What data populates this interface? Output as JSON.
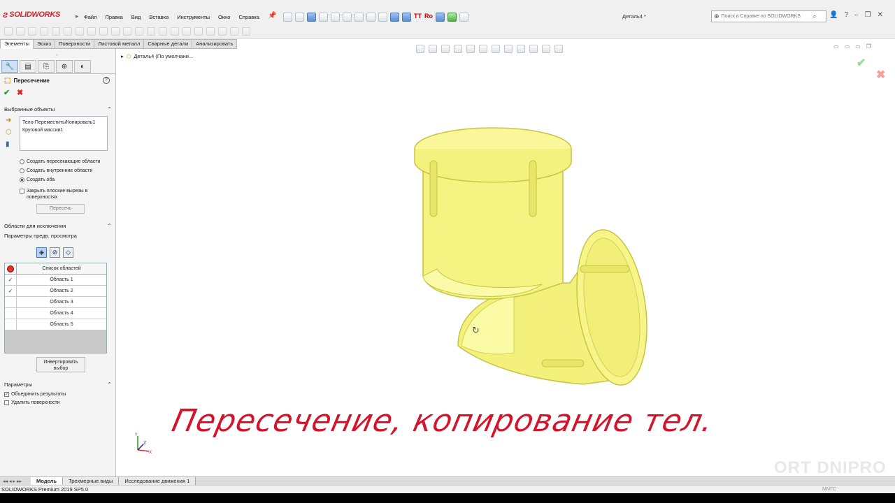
{
  "app": {
    "brand": "SOLIDWORKS",
    "document_title": "Деталь4 *",
    "status": "SOLIDWORKS Premium 2019 SP5.0",
    "units": "ММГС"
  },
  "menu": [
    "Файл",
    "Правка",
    "Вид",
    "Вставка",
    "Инструменты",
    "Окно",
    "Справка"
  ],
  "search": {
    "placeholder": "Поиск в Справке по SOLIDWORKS"
  },
  "command_tabs": [
    "Элементы",
    "Эскиз",
    "Поверхности",
    "Листовой металл",
    "Сварные детали",
    "Анализировать"
  ],
  "property_manager": {
    "title": "Пересечение",
    "help": "?",
    "selected_section": "Выбранные объекты",
    "selected_items": [
      "Тело-Переместить/Копировать1",
      "Круговой массив1"
    ],
    "options": [
      {
        "label": "Создать пересекающие области",
        "checked": false
      },
      {
        "label": "Создать внутренние области",
        "checked": false
      },
      {
        "label": "Создать оба",
        "checked": true
      }
    ],
    "close_cuts_label": "Закрыть плоские вырезы в поверхностях",
    "intersect_button": "Пересечь",
    "exclude_section": "Области для исключения",
    "preview_label": "Параметры предв. просмотра",
    "table_header": "Список областей",
    "regions": [
      {
        "name": "Область  1",
        "checked": true
      },
      {
        "name": "Область  2",
        "checked": true
      },
      {
        "name": "Область  3",
        "checked": false
      },
      {
        "name": "Область  4",
        "checked": false
      },
      {
        "name": "Область  5",
        "checked": false
      }
    ],
    "invert_button": "Инвертировать выбор",
    "params_section": "Параметры",
    "merge_label": "Объединить результаты",
    "merge_checked": true,
    "delete_label": "Удалить поверхности",
    "delete_checked": false
  },
  "graphics": {
    "tree_item": "Деталь4  (По умолчани...",
    "caption": "Пересечение, копирование тел.",
    "watermark": "ORT DNIPRO",
    "part_color": "#f7f58a",
    "part_edge": "#cfcd4a"
  },
  "bottom_tabs": [
    "Модель",
    "Трехмерные виды",
    "Исследование движения 1"
  ]
}
